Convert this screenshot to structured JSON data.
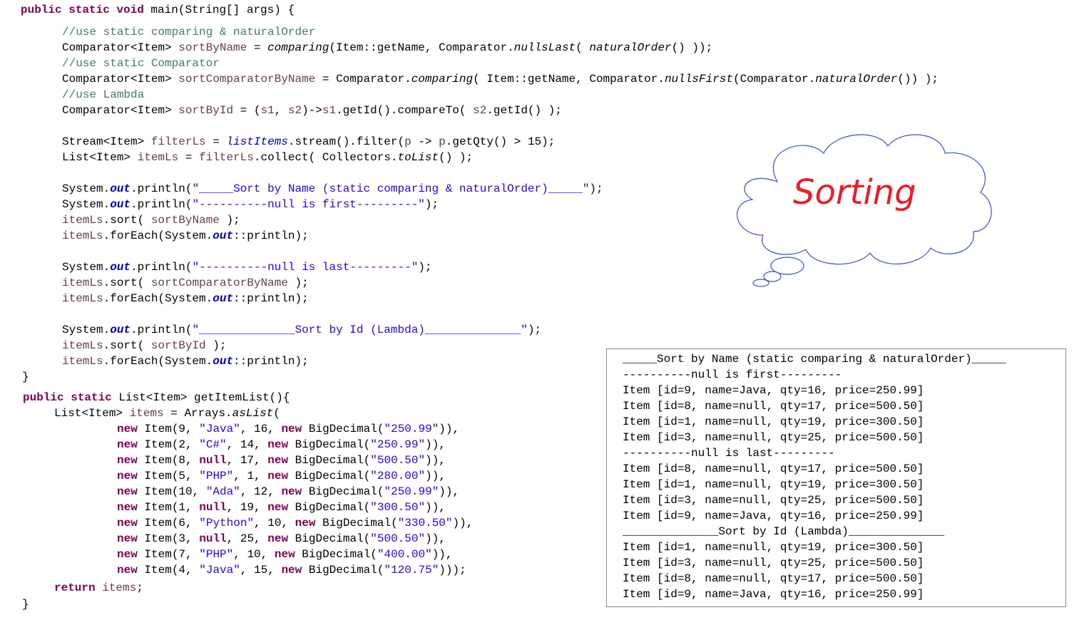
{
  "code": {
    "main_sig": [
      "public static void",
      " main(String[] args) {"
    ],
    "c1": "//use static comparing & naturalOrder",
    "l1": [
      "Comparator<Item> ",
      "sortByName",
      " = ",
      "comparing",
      "(Item::getName, Comparator.",
      "nullsLast",
      "( ",
      "naturalOrder",
      "() ));"
    ],
    "c2": "//use static Comparator",
    "l2": [
      "Comparator<Item> ",
      "sortComparatorByName",
      " = Comparator.",
      "comparing",
      "( Item::getName, Comparator.",
      "nullsFirst",
      "(Comparator.",
      "naturalOrder",
      "()) );"
    ],
    "c3": "//use Lambda",
    "l3": [
      "Comparator<Item> ",
      "sortById",
      " = (",
      "s1",
      ", ",
      "s2",
      ")->",
      "s1",
      ".getId().compareTo( ",
      "s2",
      ".getId() );"
    ],
    "l4": [
      "Stream<Item> ",
      "filterLs",
      " = ",
      "listItems",
      ".stream().filter(",
      "p",
      " -> ",
      "p",
      ".getQty() > 15);"
    ],
    "l5": [
      "List<Item> ",
      "itemLs",
      " = ",
      "filterLs",
      ".collect( Collectors.",
      "toList",
      "() );"
    ],
    "l6": [
      "System.",
      "out",
      ".println(",
      "\"_____Sort by Name (static comparing & naturalOrder)_____\"",
      ");"
    ],
    "l7": [
      "System.",
      "out",
      ".println(",
      "\"----------null is first---------\"",
      ");"
    ],
    "l8": [
      "itemLs",
      ".sort( ",
      "sortByName",
      " );"
    ],
    "l9": [
      "itemLs",
      ".forEach(System.",
      "out",
      "::println);"
    ],
    "l10": [
      "System.",
      "out",
      ".println(",
      "\"----------null is last---------\"",
      ");"
    ],
    "l11": [
      "itemLs",
      ".sort( ",
      "sortComparatorByName",
      " );"
    ],
    "l12": [
      "itemLs",
      ".forEach(System.",
      "out",
      "::println);"
    ],
    "l13": [
      "System.",
      "out",
      ".println(",
      "\"______________Sort by Id (Lambda)______________\"",
      ");"
    ],
    "l14": [
      "itemLs",
      ".sort( ",
      "sortById",
      " );"
    ],
    "l15": [
      "itemLs",
      ".forEach(System.",
      "out",
      "::println);"
    ],
    "close1": "}",
    "get_sig": [
      "public static",
      " List<Item> getItemList(){"
    ],
    "g1": [
      "List<Item> ",
      "items",
      " = Arrays.",
      "asList",
      "("
    ],
    "items": [
      [
        "new",
        " Item(9, ",
        "\"Java\"",
        ", 16, ",
        "new",
        " BigDecimal(",
        "\"250.99\"",
        ")),"
      ],
      [
        "new",
        " Item(2, ",
        "\"C#\"",
        ", 14, ",
        "new",
        " BigDecimal(",
        "\"250.99\"",
        ")),"
      ],
      [
        "new",
        " Item(8, ",
        "null",
        ", 17, ",
        "new",
        " BigDecimal(",
        "\"500.50\"",
        ")),"
      ],
      [
        "new",
        " Item(5, ",
        "\"PHP\"",
        ", 1, ",
        "new",
        " BigDecimal(",
        "\"280.00\"",
        ")),"
      ],
      [
        "new",
        " Item(10, ",
        "\"Ada\"",
        ", 12, ",
        "new",
        " BigDecimal(",
        "\"250.99\"",
        ")),"
      ],
      [
        "new",
        " Item(1, ",
        "null",
        ", 19, ",
        "new",
        " BigDecimal(",
        "\"300.50\"",
        ")),"
      ],
      [
        "new",
        " Item(6, ",
        "\"Python\"",
        ", 10, ",
        "new",
        " BigDecimal(",
        "\"330.50\"",
        ")),"
      ],
      [
        "new",
        " Item(3, ",
        "null",
        ", 25, ",
        "new",
        " BigDecimal(",
        "\"500.50\"",
        ")),"
      ],
      [
        "new",
        " Item(7, ",
        "\"PHP\"",
        ", 10, ",
        "new",
        " BigDecimal(",
        "\"400.00\"",
        ")),"
      ],
      [
        "new",
        " Item(4, ",
        "\"Java\"",
        ", 15, ",
        "new",
        " BigDecimal(",
        "\"120.75\"",
        ")));"
      ]
    ],
    "ret": [
      "return",
      " ",
      "items",
      ";"
    ],
    "close2": "}"
  },
  "output": [
    "_____Sort by Name (static comparing & naturalOrder)_____",
    "----------null is first---------",
    "Item [id=9, name=Java, qty=16, price=250.99]",
    "Item [id=8, name=null, qty=17, price=500.50]",
    "Item [id=1, name=null, qty=19, price=300.50]",
    "Item [id=3, name=null, qty=25, price=500.50]",
    "----------null is last---------",
    "Item [id=8, name=null, qty=17, price=500.50]",
    "Item [id=1, name=null, qty=19, price=300.50]",
    "Item [id=3, name=null, qty=25, price=500.50]",
    "Item [id=9, name=Java, qty=16, price=250.99]",
    "______________Sort by Id (Lambda)______________",
    "Item [id=1, name=null, qty=19, price=300.50]",
    "Item [id=3, name=null, qty=25, price=500.50]",
    "Item [id=8, name=null, qty=17, price=500.50]",
    "Item [id=9, name=Java, qty=16, price=250.99]"
  ],
  "bubble": {
    "text": "Sorting",
    "text_color": "#ee1c25",
    "outline_color": "#3b4fd8"
  },
  "syntax_colors": {
    "keyword": "#7f0055",
    "comment": "#3f7f5f",
    "field": "#0000c0",
    "string": "#2a00ff",
    "local_var": "#6a3e3e"
  }
}
